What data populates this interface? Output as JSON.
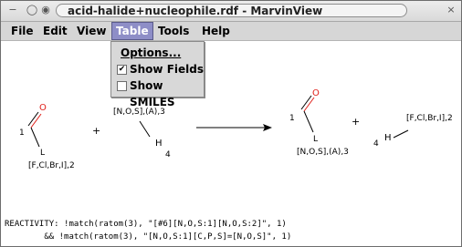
{
  "window": {
    "title": "acid-halide+nucleophile.rdf - MarvinView",
    "controls": [
      "−",
      "◯",
      "◉"
    ],
    "close": "×"
  },
  "menu": {
    "file": "File",
    "edit": "Edit",
    "view": "View",
    "table": "Table",
    "tools": "Tools",
    "help": "Help"
  },
  "dropdown": {
    "options": "Options...",
    "show_fields": "Show Fields",
    "show_fields_checked": true,
    "show_smiles": "Show SMILES",
    "show_smiles_checked": false
  },
  "reaction": {
    "left": {
      "o": "O",
      "one": "1",
      "l": "L",
      "halide": "[F,Cl,Br,I],2"
    },
    "plus1": "+",
    "nuc": {
      "top": "[N,O,S],(A),3",
      "h": "H",
      "four": "4"
    },
    "right": {
      "o": "O",
      "one": "1",
      "l": "L",
      "nuc": "[N,O,S],(A),3"
    },
    "plus2": "+",
    "byproduct": {
      "halide": "[F,Cl,Br,I],2",
      "h": "H",
      "four": "4"
    }
  },
  "fields": {
    "line1": "REACTIVITY: !match(ratom(3), \"[#6][N,O,S:1][N,O,S:2]\", 1)",
    "line2": "        && !match(ratom(3), \"[N,O,S:1][C,P,S]=[N,O,S]\", 1)"
  },
  "colors": {
    "oxygen": "#e0201a"
  }
}
